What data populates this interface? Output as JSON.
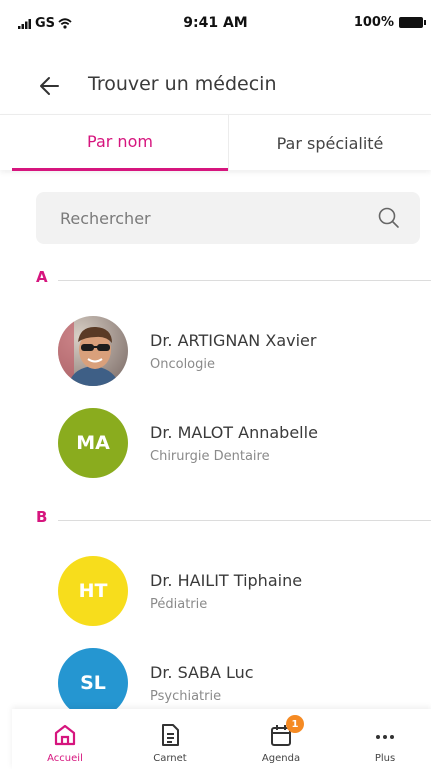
{
  "status_bar": {
    "carrier": "GS",
    "time": "9:41 AM",
    "battery": "100%"
  },
  "header": {
    "title": "Trouver un médecin",
    "back_icon": "arrow-left-icon"
  },
  "tabs": [
    {
      "label": "Par nom",
      "active": true
    },
    {
      "label": "Par spécialité",
      "active": false
    }
  ],
  "search": {
    "placeholder": "Rechercher",
    "value": "",
    "icon": "search-icon"
  },
  "sections": [
    {
      "letter": "A",
      "doctors": [
        {
          "name": "Dr. ARTIGNAN Xavier",
          "specialty": "Oncologie",
          "initials": "",
          "avatar": "photo"
        },
        {
          "name": "Dr. MALOT Annabelle",
          "specialty": "Chirurgie Dentaire",
          "initials": "MA",
          "color": "#8aac1e"
        }
      ]
    },
    {
      "letter": "B",
      "doctors": [
        {
          "name": "Dr. HAILIT Tiphaine",
          "specialty": "Pédiatrie",
          "initials": "HT",
          "color": "#f7dd1c"
        },
        {
          "name": "Dr. SABA Luc",
          "specialty": "Psychiatrie",
          "initials": "SL",
          "color": "#2596d1"
        }
      ]
    }
  ],
  "tab_bar": [
    {
      "label": "Accueil",
      "icon": "home-icon",
      "active": true
    },
    {
      "label": "Carnet",
      "icon": "document-icon",
      "active": false
    },
    {
      "label": "Agenda",
      "icon": "calendar-icon",
      "active": false,
      "badge": "1"
    },
    {
      "label": "Plus",
      "icon": "more-icon",
      "active": false
    }
  ],
  "colors": {
    "accent": "#d6157e",
    "badge": "#f58a23",
    "search_bg": "#f2f2f2"
  }
}
